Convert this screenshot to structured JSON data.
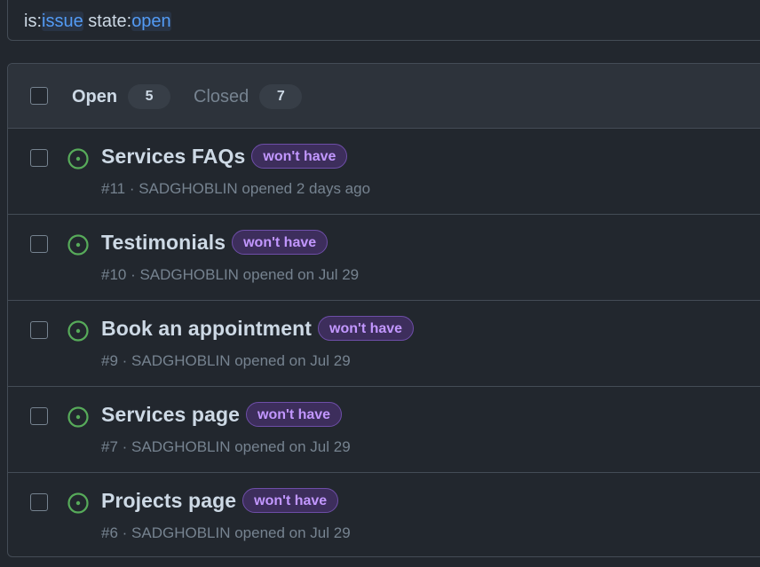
{
  "search": {
    "prefix_is": "is:",
    "value_is": "issue",
    "space": " ",
    "prefix_state": "state:",
    "value_state": "open"
  },
  "tabs": {
    "open_label": "Open",
    "open_count": "5",
    "closed_label": "Closed",
    "closed_count": "7"
  },
  "colors": {
    "open_icon": "#57ab5a",
    "label_bg": "#3d2e5c",
    "label_text": "#c297ff"
  },
  "issues": [
    {
      "title": "Services FAQs",
      "label": "won't have",
      "meta": "#11 · SADGHOBLIN opened 2 days ago",
      "icon": "issue-opened-icon"
    },
    {
      "title": "Testimonials",
      "label": "won't have",
      "meta": "#10 · SADGHOBLIN opened on Jul 29",
      "icon": "issue-opened-icon"
    },
    {
      "title": "Book an appointment",
      "label": "won't have",
      "meta": "#9 · SADGHOBLIN opened on Jul 29",
      "icon": "issue-opened-icon"
    },
    {
      "title": "Services page",
      "label": "won't have",
      "meta": "#7 · SADGHOBLIN opened on Jul 29",
      "icon": "issue-opened-icon"
    },
    {
      "title": "Projects page",
      "label": "won't have",
      "meta": "#6 · SADGHOBLIN opened on Jul 29",
      "icon": "issue-opened-icon"
    }
  ]
}
